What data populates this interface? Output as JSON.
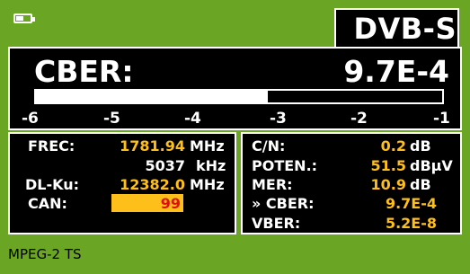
{
  "header": {
    "battery_icon": "battery-icon",
    "battery_level": 0.55,
    "mode": "DVB-S"
  },
  "cber": {
    "label": "CBER:",
    "value": "9.7E-4",
    "bar_level": 0.57,
    "scale": [
      "-6",
      "-5",
      "-4",
      "-3",
      "-2",
      "-1"
    ]
  },
  "tuning": {
    "frec_label": "FREC:",
    "frec_value": "1781.94",
    "frec_unit": "MHz",
    "symbol_rate_value": "5037",
    "symbol_rate_unit": "kHz",
    "dlku_label": "DL-Ku:",
    "dlku_value": "12382.0",
    "dlku_unit": "MHz",
    "can_label": "CAN:",
    "can_value": "99"
  },
  "measurements": [
    {
      "label": "C/N:",
      "value": "0.2",
      "unit": "dB"
    },
    {
      "label": "POTEN.:",
      "value": "51.5",
      "unit": "dBµV"
    },
    {
      "label": "MER:",
      "value": "10.9",
      "unit": "dB"
    },
    {
      "label": "» CBER:",
      "value": "9.7E-4",
      "unit": ""
    },
    {
      "label": "VBER:",
      "value": "5.2E-8",
      "unit": ""
    }
  ],
  "footer": {
    "stream_type": "MPEG-2 TS"
  },
  "colors": {
    "background": "#6aa624",
    "panel": "#000000",
    "value": "#ffbf1a",
    "channel_value": "#dd1111"
  }
}
